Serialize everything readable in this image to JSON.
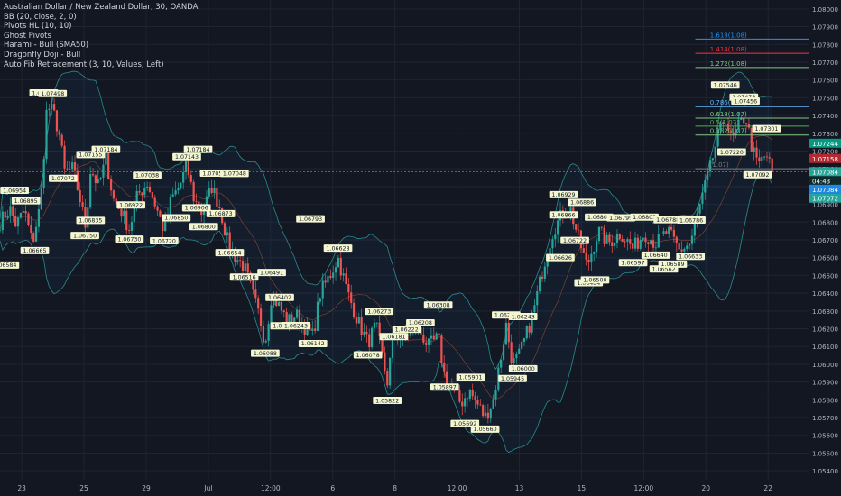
{
  "chart_data": {
    "type": "candlestick",
    "title": "Australian Dollar / New Zealand Dollar, 30, OANDA",
    "indicators": [
      "BB (20, close, 2, 0)",
      "Pivots HL (10, 10)",
      "Ghost Pivots",
      "Harami - Bull (SMA50)",
      "Dragonfly Doji - Bull",
      "Auto Fib Retracement (3, 10, Values, Left)"
    ],
    "ylim": [
      1.0535,
      1.0805
    ],
    "y_ticks": [
      "1.08000",
      "1.07900",
      "1.07800",
      "1.07700",
      "1.07600",
      "1.07500",
      "1.07400",
      "1.07300",
      "1.07200",
      "1.07100",
      "1.07000",
      "1.06900",
      "1.06800",
      "1.06700",
      "1.06600",
      "1.06500",
      "1.06400",
      "1.06300",
      "1.06200",
      "1.06100",
      "1.06000",
      "1.05900",
      "1.05800",
      "1.05700",
      "1.05600",
      "1.05500",
      "1.05400"
    ],
    "x_ticks": [
      "23",
      "25",
      "29",
      "Jul",
      "12:00",
      "6",
      "8",
      "12:00",
      "13",
      "15",
      "12:00",
      "20",
      "22"
    ],
    "last_price": 1.07084,
    "price_tags": [
      {
        "text": "1.07244",
        "price": 1.07244,
        "color": "#089981"
      },
      {
        "text": "1.07158",
        "price": 1.07158,
        "color": "#b22833"
      },
      {
        "text": "1.07084",
        "price": 1.07084,
        "color": "#26a69a"
      },
      {
        "text": "04:43",
        "price": 1.07033,
        "color": "#0f2a2b"
      },
      {
        "text": "1.07084",
        "price": 1.06985,
        "color": "#1e88e5"
      },
      {
        "text": "1.07072",
        "price": 1.06935,
        "color": "#26a69a"
      }
    ],
    "fib_levels": [
      {
        "label": "1.618(1.08)",
        "price": 1.0783,
        "color": "#2196f3"
      },
      {
        "label": "1.414(1.08)",
        "price": 1.0775,
        "color": "#f23645"
      },
      {
        "label": "1.272(1.08)",
        "price": 1.0767,
        "color": "#81c784"
      },
      {
        "label": "0.786(1.07)",
        "price": 1.0745,
        "color": "#64b5f6"
      },
      {
        "label": "0.618(1.07)",
        "price": 1.07385,
        "color": "#81c784"
      },
      {
        "label": "0.5(1.07)",
        "price": 1.0734,
        "color": "#4caf50"
      },
      {
        "label": "0.382(1.07)",
        "price": 1.0729,
        "color": "#81c784"
      },
      {
        "label": "(1.07)",
        "price": 1.071,
        "color": "#787b86"
      }
    ],
    "pivots": [
      {
        "x": 0.018,
        "price": 1.06954,
        "label": "1.06954",
        "type": "high"
      },
      {
        "x": 0.032,
        "price": 1.06895,
        "label": "1.06895",
        "type": "high"
      },
      {
        "x": 0.006,
        "price": 1.06584,
        "label": "1.06584",
        "type": "low"
      },
      {
        "x": 0.043,
        "price": 1.06665,
        "label": "1.06665",
        "type": "low"
      },
      {
        "x": 0.054,
        "price": 1.07502,
        "label": "1.07502",
        "type": "high"
      },
      {
        "x": 0.065,
        "price": 1.07498,
        "label": "1.07498",
        "type": "high"
      },
      {
        "x": 0.078,
        "price": 1.07072,
        "label": "1.07072",
        "type": "low"
      },
      {
        "x": 0.112,
        "price": 1.06835,
        "label": "1.06835",
        "type": "low"
      },
      {
        "x": 0.112,
        "price": 1.07155,
        "label": "1.07155",
        "type": "high"
      },
      {
        "x": 0.131,
        "price": 1.07184,
        "label": "1.07184",
        "type": "high"
      },
      {
        "x": 0.105,
        "price": 1.0675,
        "label": "1.06750",
        "type": "low"
      },
      {
        "x": 0.16,
        "price": 1.0673,
        "label": "1.06730",
        "type": "low"
      },
      {
        "x": 0.162,
        "price": 1.06922,
        "label": "1.06922",
        "type": "low"
      },
      {
        "x": 0.182,
        "price": 1.07038,
        "label": "1.07038",
        "type": "high"
      },
      {
        "x": 0.203,
        "price": 1.0672,
        "label": "1.06720",
        "type": "low"
      },
      {
        "x": 0.218,
        "price": 1.0685,
        "label": "1.06850",
        "type": "low"
      },
      {
        "x": 0.231,
        "price": 1.07143,
        "label": "1.07143",
        "type": "high"
      },
      {
        "x": 0.245,
        "price": 1.07184,
        "label": "1.07184",
        "type": "high"
      },
      {
        "x": 0.243,
        "price": 1.06906,
        "label": "1.06906",
        "type": "low"
      },
      {
        "x": 0.252,
        "price": 1.068,
        "label": "1.06800",
        "type": "low"
      },
      {
        "x": 0.265,
        "price": 1.0705,
        "label": "1.07050",
        "type": "high"
      },
      {
        "x": 0.29,
        "price": 1.07048,
        "label": "1.07048",
        "type": "high"
      },
      {
        "x": 0.273,
        "price": 1.06873,
        "label": "1.06873",
        "type": "low"
      },
      {
        "x": 0.284,
        "price": 1.06654,
        "label": "1.06654",
        "type": "low"
      },
      {
        "x": 0.302,
        "price": 1.06516,
        "label": "1.06516",
        "type": "low"
      },
      {
        "x": 0.336,
        "price": 1.06491,
        "label": "1.06491",
        "type": "high"
      },
      {
        "x": 0.346,
        "price": 1.06402,
        "label": "1.06402",
        "type": "low"
      },
      {
        "x": 0.328,
        "price": 1.06088,
        "label": "1.06088",
        "type": "low"
      },
      {
        "x": 0.352,
        "price": 1.06242,
        "label": "1.06242",
        "type": "low"
      },
      {
        "x": 0.366,
        "price": 1.06243,
        "label": "1.06243",
        "type": "low"
      },
      {
        "x": 0.387,
        "price": 1.06142,
        "label": "1.06142",
        "type": "low"
      },
      {
        "x": 0.384,
        "price": 1.06793,
        "label": "1.06793",
        "type": "high"
      },
      {
        "x": 0.418,
        "price": 1.06628,
        "label": "1.06628",
        "type": "high"
      },
      {
        "x": 0.469,
        "price": 1.06273,
        "label": "1.06273",
        "type": "high"
      },
      {
        "x": 0.487,
        "price": 1.06181,
        "label": "1.06181",
        "type": "low"
      },
      {
        "x": 0.455,
        "price": 1.06078,
        "label": "1.06078",
        "type": "low"
      },
      {
        "x": 0.503,
        "price": 1.06222,
        "label": "1.06222",
        "type": "low"
      },
      {
        "x": 0.52,
        "price": 1.06208,
        "label": "1.06208",
        "type": "high"
      },
      {
        "x": 0.542,
        "price": 1.06308,
        "label": "1.06308",
        "type": "high"
      },
      {
        "x": 0.479,
        "price": 1.05822,
        "label": "1.05822",
        "type": "low"
      },
      {
        "x": 0.55,
        "price": 1.05897,
        "label": "1.05897",
        "type": "low"
      },
      {
        "x": 0.582,
        "price": 1.05901,
        "label": "1.05901",
        "type": "high"
      },
      {
        "x": 0.575,
        "price": 1.05692,
        "label": "1.05692",
        "type": "low"
      },
      {
        "x": 0.6,
        "price": 1.0566,
        "label": "1.05660",
        "type": "low"
      },
      {
        "x": 0.626,
        "price": 1.06252,
        "label": "1.06252",
        "type": "high"
      },
      {
        "x": 0.647,
        "price": 1.06243,
        "label": "1.06243",
        "type": "high"
      },
      {
        "x": 0.634,
        "price": 1.05945,
        "label": "1.05945",
        "type": "low"
      },
      {
        "x": 0.647,
        "price": 1.06,
        "label": "1.06000",
        "type": "low"
      },
      {
        "x": 0.697,
        "price": 1.06929,
        "label": "1.06929",
        "type": "high"
      },
      {
        "x": 0.72,
        "price": 1.06886,
        "label": "1.06886",
        "type": "high"
      },
      {
        "x": 0.697,
        "price": 1.06866,
        "label": "1.06866",
        "type": "low"
      },
      {
        "x": 0.711,
        "price": 1.06722,
        "label": "1.06722",
        "type": "low"
      },
      {
        "x": 0.693,
        "price": 1.06626,
        "label": "1.06626",
        "type": "low"
      },
      {
        "x": 0.741,
        "price": 1.06803,
        "label": "1.06803",
        "type": "high"
      },
      {
        "x": 0.768,
        "price": 1.06799,
        "label": "1.06799",
        "type": "high"
      },
      {
        "x": 0.797,
        "price": 1.06803,
        "label": "1.06803",
        "type": "high"
      },
      {
        "x": 0.826,
        "price": 1.06788,
        "label": "1.06788",
        "type": "high"
      },
      {
        "x": 0.855,
        "price": 1.06786,
        "label": "1.06786",
        "type": "high"
      },
      {
        "x": 0.728,
        "price": 1.06484,
        "label": "1.06484",
        "type": "low"
      },
      {
        "x": 0.736,
        "price": 1.065,
        "label": "1.06500",
        "type": "low"
      },
      {
        "x": 0.783,
        "price": 1.06597,
        "label": "1.06597",
        "type": "low"
      },
      {
        "x": 0.811,
        "price": 1.0664,
        "label": "1.06640",
        "type": "low"
      },
      {
        "x": 0.821,
        "price": 1.06562,
        "label": "1.06562",
        "type": "low"
      },
      {
        "x": 0.832,
        "price": 1.06589,
        "label": "1.06589",
        "type": "low"
      },
      {
        "x": 0.854,
        "price": 1.06633,
        "label": "1.06633",
        "type": "low"
      },
      {
        "x": 0.897,
        "price": 1.07546,
        "label": "1.07546",
        "type": "high"
      },
      {
        "x": 0.92,
        "price": 1.07478,
        "label": "1.07478",
        "type": "high"
      },
      {
        "x": 0.922,
        "price": 1.07456,
        "label": "1.07456",
        "type": "high"
      },
      {
        "x": 0.948,
        "price": 1.07301,
        "label": "1.07301",
        "type": "high"
      },
      {
        "x": 0.905,
        "price": 1.0722,
        "label": "1.07220",
        "type": "low"
      },
      {
        "x": 0.937,
        "price": 1.07092,
        "label": "1.07092",
        "type": "low"
      }
    ],
    "path": [
      [
        0.0,
        1.068
      ],
      [
        0.012,
        1.0688
      ],
      [
        0.02,
        1.0678
      ],
      [
        0.03,
        1.0687
      ],
      [
        0.04,
        1.0668
      ],
      [
        0.05,
        1.069
      ],
      [
        0.058,
        1.0745
      ],
      [
        0.066,
        1.0742
      ],
      [
        0.074,
        1.0728
      ],
      [
        0.08,
        1.0708
      ],
      [
        0.09,
        1.071
      ],
      [
        0.098,
        1.0695
      ],
      [
        0.106,
        1.0677
      ],
      [
        0.112,
        1.071
      ],
      [
        0.122,
        1.07
      ],
      [
        0.131,
        1.0716
      ],
      [
        0.14,
        1.0693
      ],
      [
        0.15,
        1.0686
      ],
      [
        0.16,
        1.0676
      ],
      [
        0.17,
        1.0695
      ],
      [
        0.182,
        1.0702
      ],
      [
        0.192,
        1.069
      ],
      [
        0.203,
        1.0675
      ],
      [
        0.212,
        1.0693
      ],
      [
        0.222,
        1.07
      ],
      [
        0.231,
        1.0712
      ],
      [
        0.24,
        1.0693
      ],
      [
        0.25,
        1.0685
      ],
      [
        0.262,
        1.07
      ],
      [
        0.272,
        1.0688
      ],
      [
        0.282,
        1.0668
      ],
      [
        0.292,
        1.066
      ],
      [
        0.302,
        1.0655
      ],
      [
        0.312,
        1.064
      ],
      [
        0.322,
        1.0625
      ],
      [
        0.328,
        1.0612
      ],
      [
        0.336,
        1.064
      ],
      [
        0.346,
        1.0632
      ],
      [
        0.356,
        1.0624
      ],
      [
        0.366,
        1.0628
      ],
      [
        0.378,
        1.062
      ],
      [
        0.387,
        1.0616
      ],
      [
        0.396,
        1.064
      ],
      [
        0.408,
        1.065
      ],
      [
        0.418,
        1.066
      ],
      [
        0.43,
        1.064
      ],
      [
        0.442,
        1.0625
      ],
      [
        0.455,
        1.0612
      ],
      [
        0.465,
        1.0622
      ],
      [
        0.479,
        1.059
      ],
      [
        0.487,
        1.0618
      ],
      [
        0.498,
        1.0614
      ],
      [
        0.51,
        1.062
      ],
      [
        0.52,
        1.0618
      ],
      [
        0.53,
        1.061
      ],
      [
        0.542,
        1.0615
      ],
      [
        0.55,
        1.0593
      ],
      [
        0.56,
        1.0585
      ],
      [
        0.57,
        1.0578
      ],
      [
        0.58,
        1.0585
      ],
      [
        0.59,
        1.0578
      ],
      [
        0.6,
        1.057
      ],
      [
        0.61,
        1.058
      ],
      [
        0.618,
        1.06
      ],
      [
        0.626,
        1.0622
      ],
      [
        0.634,
        1.06
      ],
      [
        0.642,
        1.0605
      ],
      [
        0.65,
        1.0615
      ],
      [
        0.66,
        1.063
      ],
      [
        0.672,
        1.0655
      ],
      [
        0.684,
        1.0675
      ],
      [
        0.697,
        1.0686
      ],
      [
        0.705,
        1.0688
      ],
      [
        0.716,
        1.067
      ],
      [
        0.726,
        1.0655
      ],
      [
        0.74,
        1.0675
      ],
      [
        0.752,
        1.0668
      ],
      [
        0.768,
        1.0674
      ],
      [
        0.783,
        1.0665
      ],
      [
        0.797,
        1.0674
      ],
      [
        0.811,
        1.0668
      ],
      [
        0.826,
        1.0675
      ],
      [
        0.84,
        1.0664
      ],
      [
        0.854,
        1.0668
      ],
      [
        0.866,
        1.069
      ],
      [
        0.878,
        1.071
      ],
      [
        0.886,
        1.0725
      ],
      [
        0.897,
        1.074
      ],
      [
        0.905,
        1.0725
      ],
      [
        0.915,
        1.0735
      ],
      [
        0.922,
        1.074
      ],
      [
        0.93,
        1.0722
      ],
      [
        0.937,
        1.0712
      ],
      [
        0.948,
        1.0718
      ],
      [
        0.955,
        1.0708
      ]
    ]
  }
}
